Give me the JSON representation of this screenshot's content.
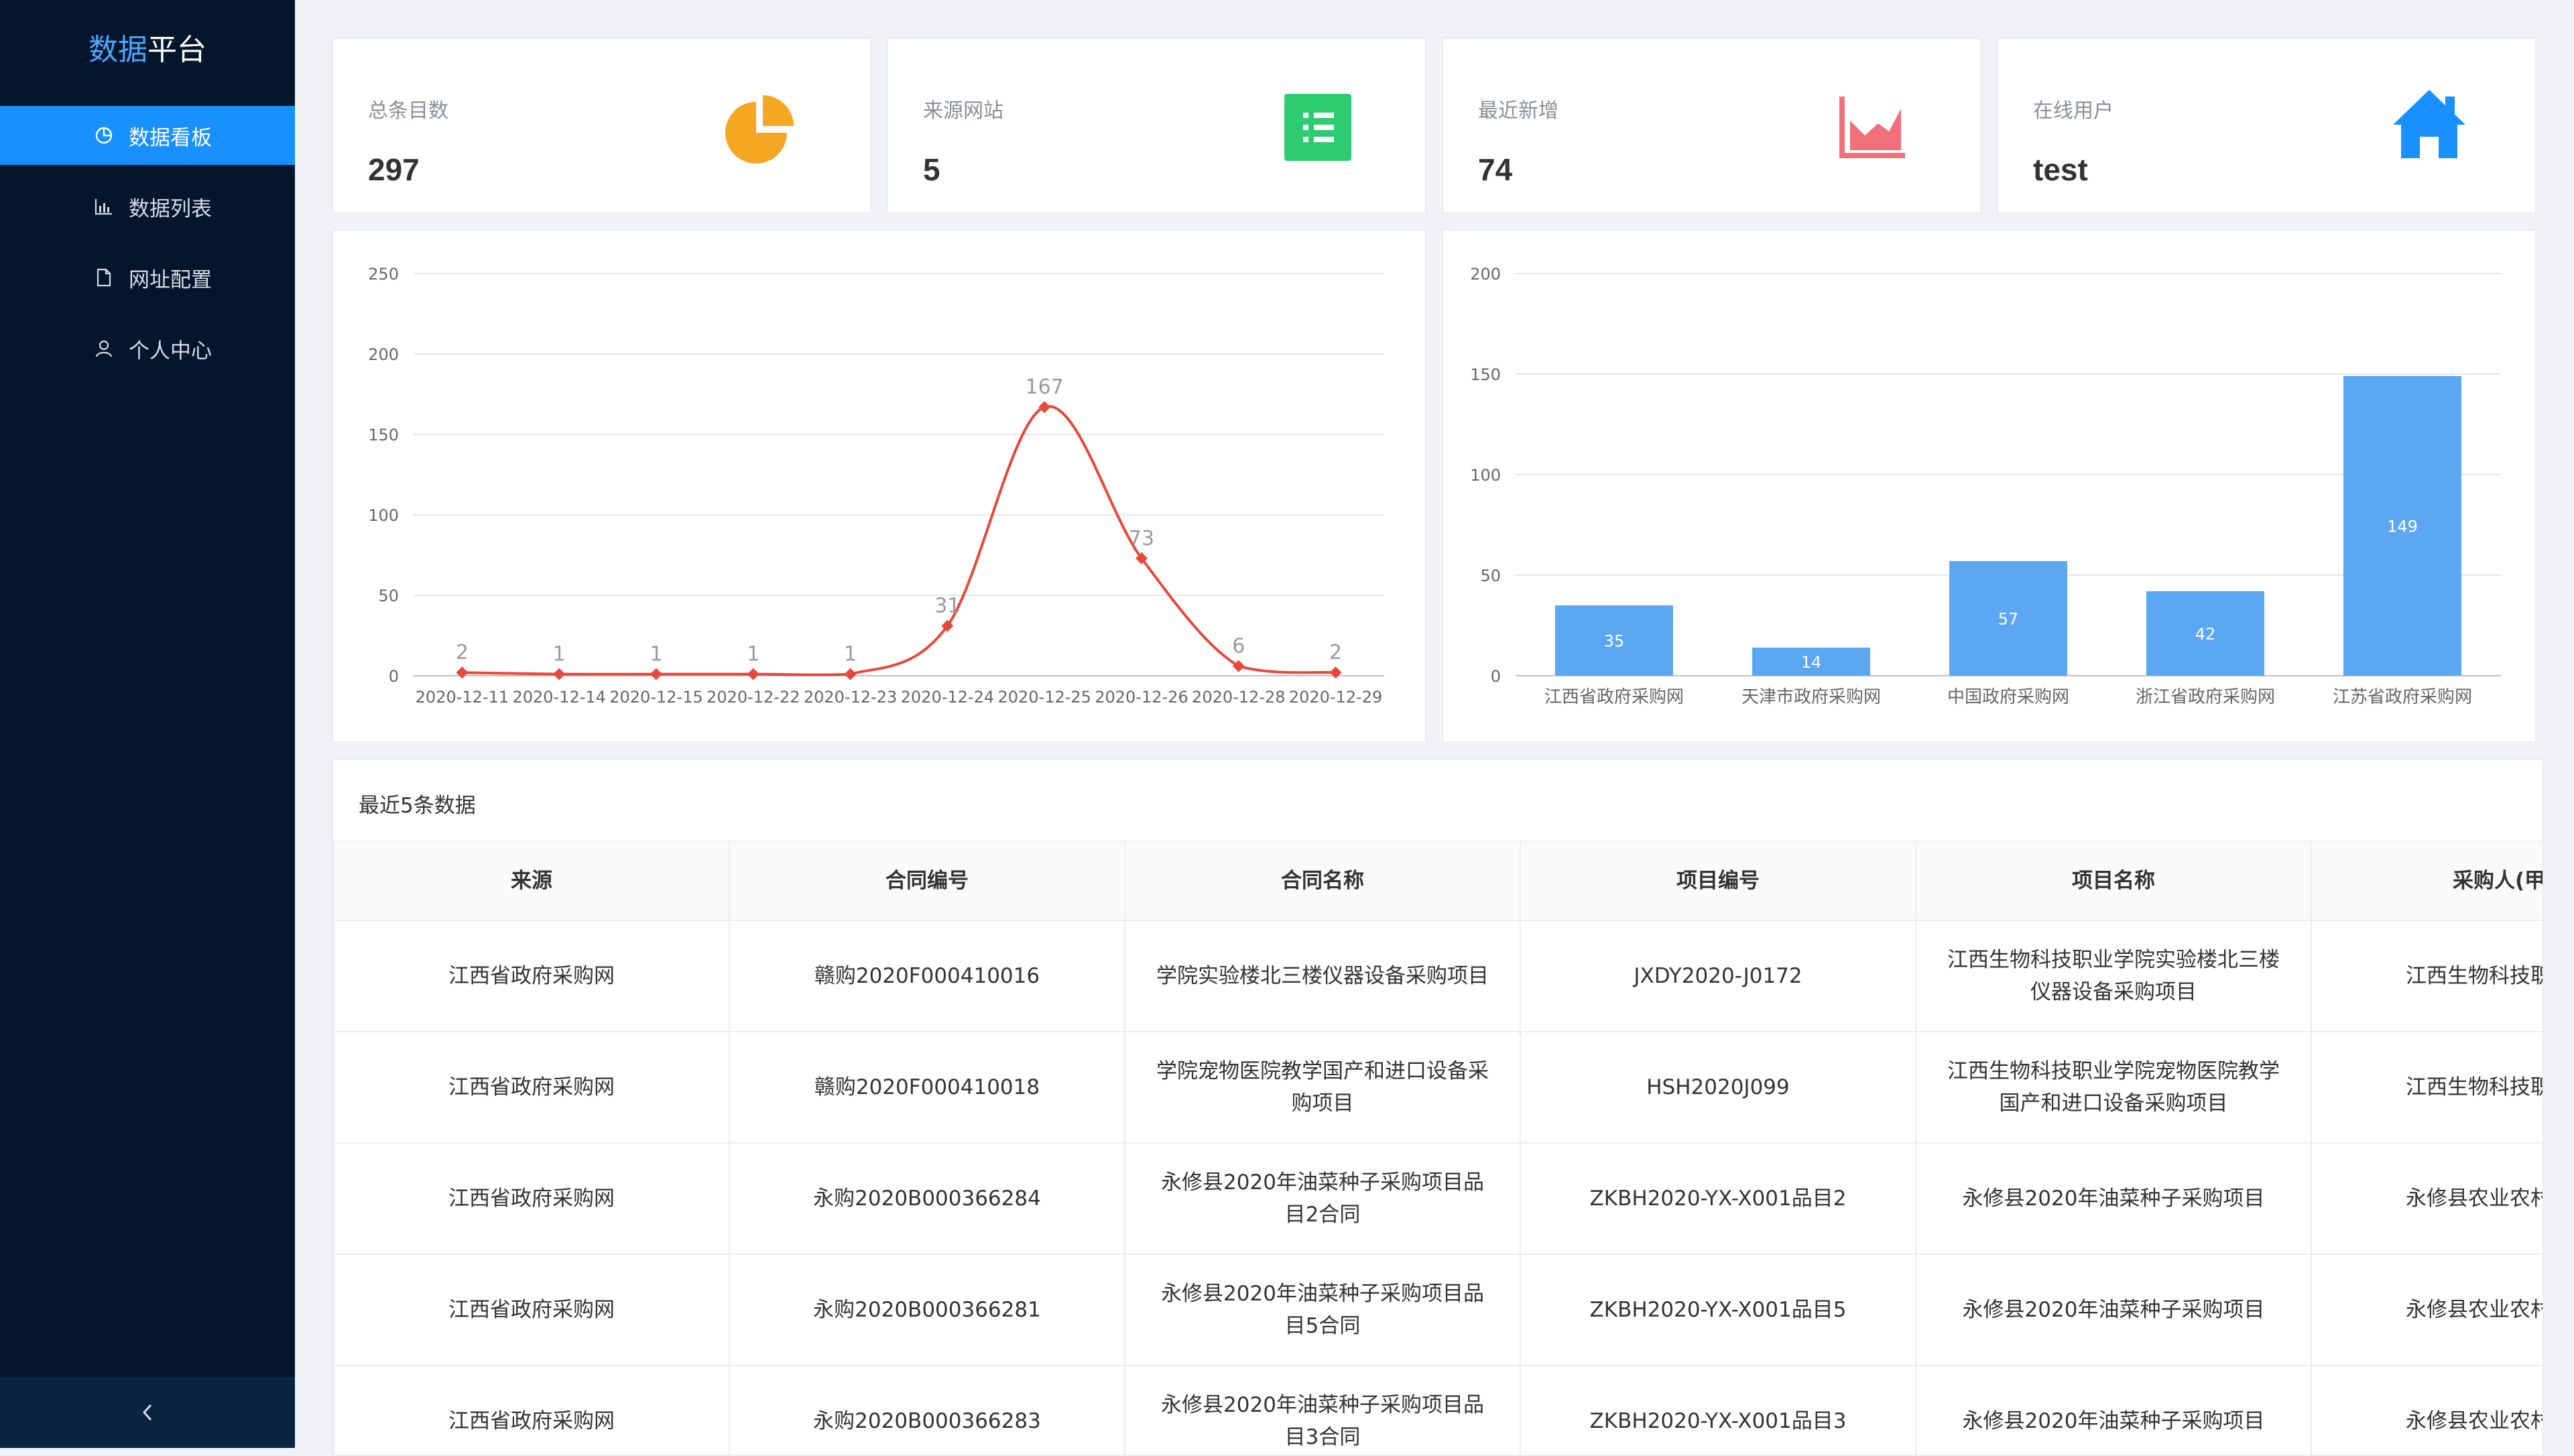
{
  "app": {
    "title_part1": "数据",
    "title_part2": "平台"
  },
  "sidebar": {
    "items": [
      {
        "label": "数据看板",
        "icon": "pie-chart-icon",
        "active": true
      },
      {
        "label": "数据列表",
        "icon": "bar-chart-icon",
        "active": false
      },
      {
        "label": "网址配置",
        "icon": "file-icon",
        "active": false
      },
      {
        "label": "个人中心",
        "icon": "user-icon",
        "active": false
      }
    ],
    "collapse_icon": "chevron-left-icon"
  },
  "stats": [
    {
      "label": "总条目数",
      "value": "297",
      "icon": "pie-chart-icon",
      "color": "#f5a623"
    },
    {
      "label": "来源网站",
      "value": "5",
      "icon": "list-icon",
      "color": "#2ecc71"
    },
    {
      "label": "最近新增",
      "value": "74",
      "icon": "area-chart-icon",
      "color": "#f0707a"
    },
    {
      "label": "在线用户",
      "value": "test",
      "icon": "home-icon",
      "color": "#1890ff"
    }
  ],
  "chart_data": [
    {
      "type": "line",
      "x": [
        "2020-12-11",
        "2020-12-14",
        "2020-12-15",
        "2020-12-22",
        "2020-12-23",
        "2020-12-24",
        "2020-12-25",
        "2020-12-26",
        "2020-12-28",
        "2020-12-29"
      ],
      "series": [
        {
          "values": [
            2,
            1,
            1,
            1,
            1,
            31,
            167,
            73,
            6,
            2
          ],
          "color": "#e8473c"
        }
      ],
      "ylim": [
        0,
        250
      ],
      "yticks": [
        0,
        50,
        100,
        150,
        200,
        250
      ],
      "smooth": true,
      "grid": true
    },
    {
      "type": "bar",
      "categories": [
        "江西省政府采购网",
        "天津市政府采购网",
        "中国政府采购网",
        "浙江省政府采购网",
        "江苏省政府采购网"
      ],
      "values": [
        35,
        14,
        57,
        42,
        149
      ],
      "color": "#5ba7f2",
      "ylim": [
        0,
        200
      ],
      "yticks": [
        0,
        50,
        100,
        150,
        200
      ],
      "grid": true
    }
  ],
  "table": {
    "title": "最近5条数据",
    "columns": [
      "来源",
      "合同编号",
      "合同名称",
      "项目编号",
      "项目名称",
      "采购人(甲"
    ],
    "rows": [
      [
        "江西省政府采购网",
        "赣购2020F000410016",
        "学院实验楼北三楼仪器设备采购项目",
        "JXDY2020-J0172",
        "江西生物科技职业学院实验楼北三楼仪器设备采购项目",
        "江西生物科技职"
      ],
      [
        "江西省政府采购网",
        "赣购2020F000410018",
        "学院宠物医院教学国产和进口设备采购项目",
        "HSH2020J099",
        "江西生物科技职业学院宠物医院教学国产和进口设备采购项目",
        "江西生物科技职"
      ],
      [
        "江西省政府采购网",
        "永购2020B000366284",
        "永修县2020年油菜种子采购项目品目2合同",
        "ZKBH2020-YX-X001品目2",
        "永修县2020年油菜种子采购项目",
        "永修县农业农村"
      ],
      [
        "江西省政府采购网",
        "永购2020B000366281",
        "永修县2020年油菜种子采购项目品目5合同",
        "ZKBH2020-YX-X001品目5",
        "永修县2020年油菜种子采购项目",
        "永修县农业农村"
      ],
      [
        "江西省政府采购网",
        "永购2020B000366283",
        "永修县2020年油菜种子采购项目品目3合同",
        "ZKBH2020-YX-X001品目3",
        "永修县2020年油菜种子采购项目",
        "永修县农业农村"
      ]
    ]
  }
}
